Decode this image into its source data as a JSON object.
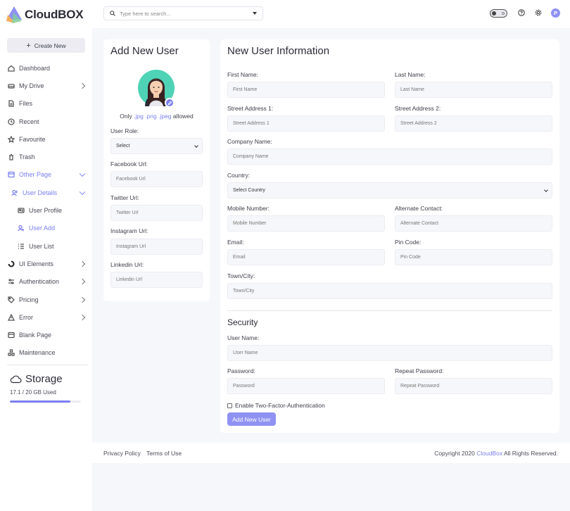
{
  "app": {
    "brand": "CloudBOX"
  },
  "sidebar": {
    "create_label": "Create New",
    "items": [
      {
        "label": "Dashboard"
      },
      {
        "label": "My Drive"
      },
      {
        "label": "Files"
      },
      {
        "label": "Recent"
      },
      {
        "label": "Favourite"
      },
      {
        "label": "Trash"
      },
      {
        "label": "Other Page"
      },
      {
        "label": "User Details"
      },
      {
        "label": "User Profile"
      },
      {
        "label": "User Add"
      },
      {
        "label": "User List"
      },
      {
        "label": "UI Elements"
      },
      {
        "label": "Authentication"
      },
      {
        "label": "Pricing"
      },
      {
        "label": "Error"
      },
      {
        "label": "Blank Page"
      },
      {
        "label": "Maintenance"
      }
    ],
    "storage": {
      "title": "Storage",
      "used": "17.1 / 20 GB Used",
      "fraction": 0.855
    }
  },
  "topbar": {
    "search_placeholder": "Type here to search...",
    "avatar_initial": "P"
  },
  "left_card": {
    "title": "Add New User",
    "allowed_prefix": "Only",
    "allowed_ext": ".jpg .png .jpeg",
    "allowed_suffix": "allowed",
    "role_label": "User Role:",
    "role_value": "Select",
    "facebook_label": "Facebook Url:",
    "facebook_placeholder": "Facebook Url",
    "twitter_label": "Twitter Url:",
    "twitter_placeholder": "Twitter Url",
    "instagram_label": "Instagram Url:",
    "instagram_placeholder": "Instagram Url",
    "linkedin_label": "Linkedin Url:",
    "linkedin_placeholder": "Linkedin Url"
  },
  "right_card": {
    "title": "New User Information",
    "first_name": {
      "label": "First Name:",
      "placeholder": "First Name"
    },
    "last_name": {
      "label": "Last Name:",
      "placeholder": "Last Name"
    },
    "street1": {
      "label": "Street Address 1:",
      "placeholder": "Street Address 1"
    },
    "street2": {
      "label": "Street Address 2:",
      "placeholder": "Street Address 2"
    },
    "company": {
      "label": "Company Name:",
      "placeholder": "Company Name"
    },
    "country": {
      "label": "Country:",
      "value": "Select Country"
    },
    "mobile": {
      "label": "Mobile Number:",
      "placeholder": "Mobile Number"
    },
    "alt_contact": {
      "label": "Alternate Contact:",
      "placeholder": "Alternate Contact"
    },
    "email": {
      "label": "Email:",
      "placeholder": "Email"
    },
    "pin": {
      "label": "Pin Code:",
      "placeholder": "Pin Code"
    },
    "town": {
      "label": "Town/City:",
      "placeholder": "Town/City"
    },
    "security_title": "Security",
    "username": {
      "label": "User Name:",
      "placeholder": "User Name"
    },
    "password": {
      "label": "Password:",
      "placeholder": "Password"
    },
    "repeat_password": {
      "label": "Repeat Password:",
      "placeholder": "Repeat Password"
    },
    "two_factor_label": "Enable Two-Factor-Authentication",
    "submit_label": "Add New User"
  },
  "footer": {
    "privacy": "Privacy Policy",
    "terms": "Terms of Use",
    "copy_prefix": "Copyright 2020",
    "copy_brand": "CloudBox",
    "copy_suffix": "All Rights Reserved."
  },
  "colors": {
    "accent": "#7b7ff0",
    "button": "#8f92f2",
    "background": "#f6f7fb"
  }
}
